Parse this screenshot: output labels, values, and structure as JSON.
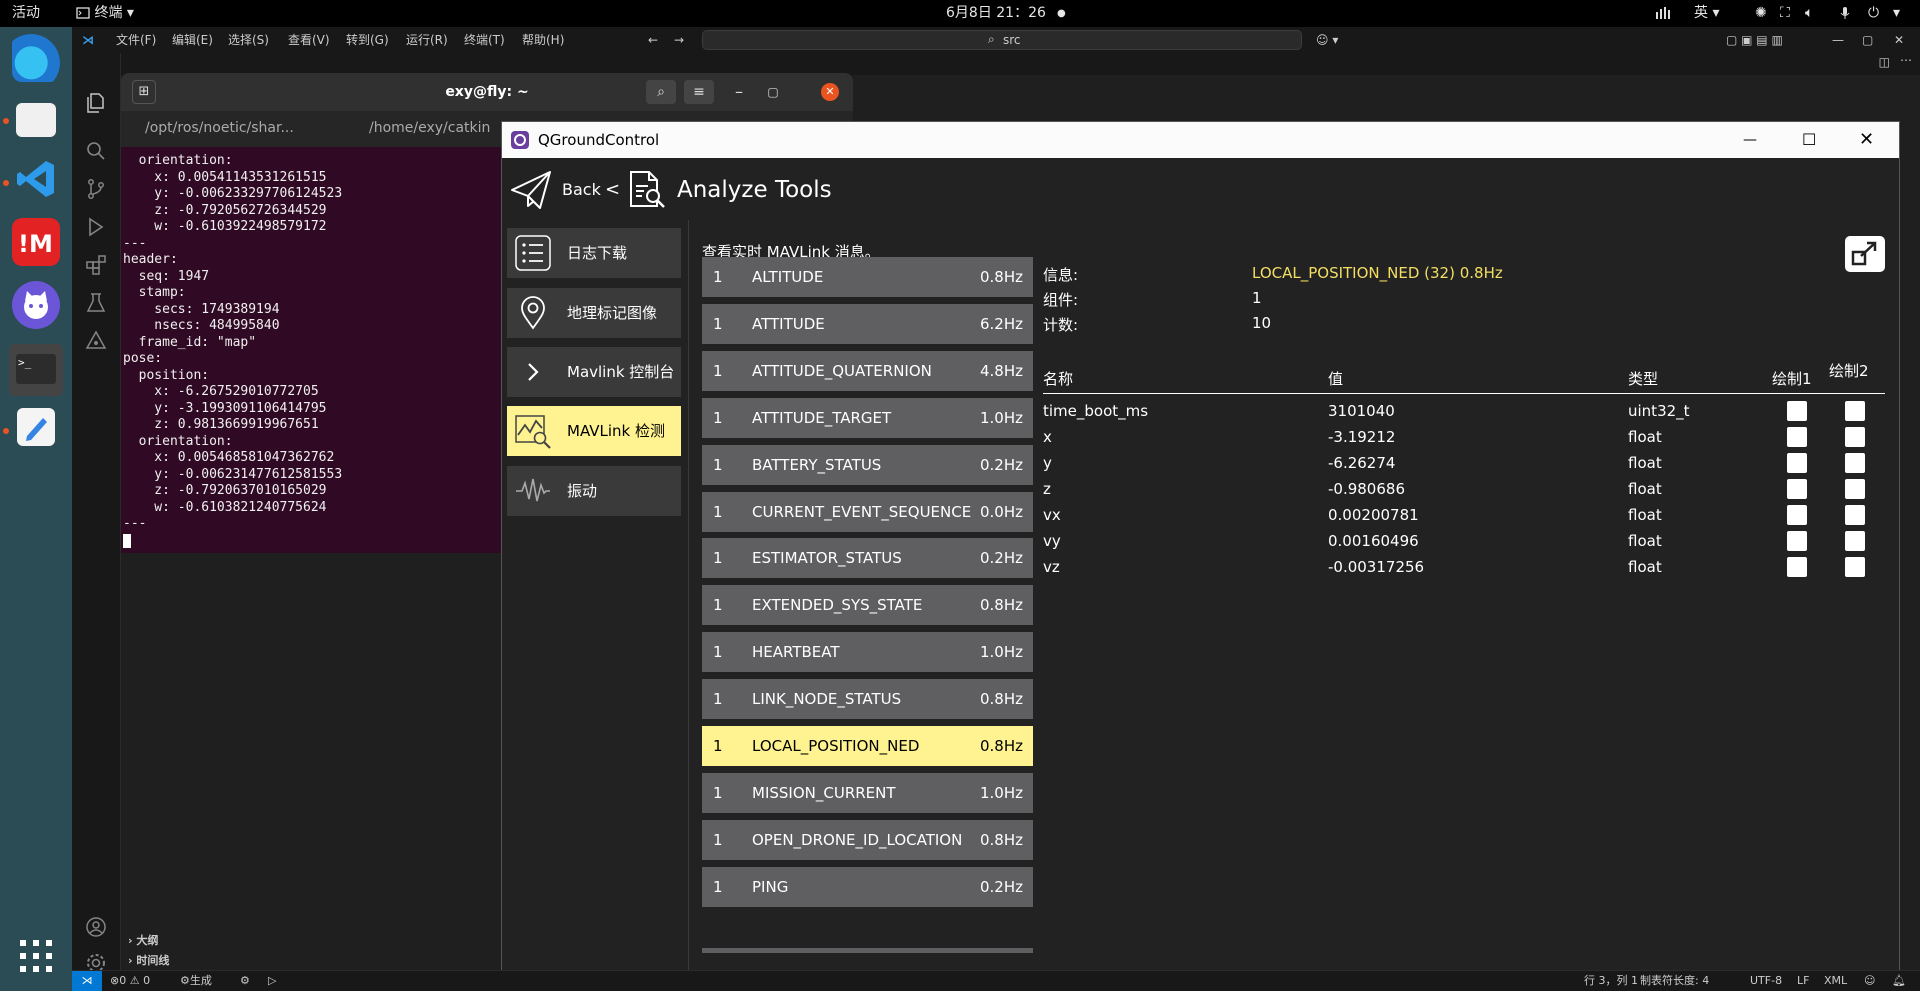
{
  "topbar": {
    "activities": "活动",
    "app_menu": "终端",
    "clock": "6月8日  21：26",
    "input_method": "英"
  },
  "vscode": {
    "menu": [
      "文件(F)",
      "编辑(E)",
      "选择(S)",
      "查看(V)",
      "转到(G)",
      "运行(R)",
      "终端(T)",
      "帮助(H)"
    ],
    "search": "src",
    "outline": "大纲",
    "timeline": "时间线",
    "status_problems": "0 ⚠ 0",
    "status_left_label": "生成",
    "status_right": [
      "行 3，列 1",
      "制表符长度: 4",
      "UTF-8",
      "LF",
      "XML"
    ]
  },
  "terminal": {
    "title": "exy@fly: ~",
    "tab1": "/opt/ros/noetic/shar...",
    "tab2": "/home/exy/catkin",
    "lines": [
      "  orientation:",
      "    x: 0.0054114353126151​5",
      "    y: -0.006233297706124523",
      "    z: -0.7920562726344529",
      "    w: -0.6103922498579172",
      "---",
      "header:",
      "  seq: 1947",
      "  stamp:",
      "    secs: 1749389194",
      "    nsecs: 484995840",
      "  frame_id: \"map\"",
      "pose:",
      "  position:",
      "    x: -6.267529010772705",
      "    y: -3.1993091106414795",
      "    z: 0.9813669919967651",
      "  orientation:",
      "    x: 0.005468581047362762",
      "    y: -0.006231477612581553",
      "    z: -0.7920637010165029",
      "    w: -0.6103821240775624",
      "---"
    ]
  },
  "qgc": {
    "window_title": "QGroundControl",
    "back": "Back",
    "separator": "<",
    "page_title": "Analyze Tools",
    "nav": [
      {
        "label": "日志下载",
        "icon": "list-icon"
      },
      {
        "label": "地理标记图像",
        "icon": "map-pin-icon"
      },
      {
        "label": "Mavlink 控制台",
        "icon": "chevron-right-icon"
      },
      {
        "label": "MAVLink 检测",
        "icon": "chart-search-icon"
      },
      {
        "label": "振动",
        "icon": "waveform-icon"
      }
    ],
    "header_text": "查看实时 MAVLink 消息。",
    "messages": [
      {
        "cid": "1",
        "name": "ALTITUDE",
        "hz": "0.8Hz"
      },
      {
        "cid": "1",
        "name": "ATTITUDE",
        "hz": "6.2Hz"
      },
      {
        "cid": "1",
        "name": "ATTITUDE_QUATERNION",
        "hz": "4.8Hz"
      },
      {
        "cid": "1",
        "name": "ATTITUDE_TARGET",
        "hz": "1.0Hz"
      },
      {
        "cid": "1",
        "name": "BATTERY_STATUS",
        "hz": "0.2Hz"
      },
      {
        "cid": "1",
        "name": "CURRENT_EVENT_SEQUENCE",
        "hz": "0.0Hz"
      },
      {
        "cid": "1",
        "name": "ESTIMATOR_STATUS",
        "hz": "0.2Hz"
      },
      {
        "cid": "1",
        "name": "EXTENDED_SYS_STATE",
        "hz": "0.8Hz"
      },
      {
        "cid": "1",
        "name": "HEARTBEAT",
        "hz": "1.0Hz"
      },
      {
        "cid": "1",
        "name": "LINK_NODE_STATUS",
        "hz": "0.8Hz"
      },
      {
        "cid": "1",
        "name": "LOCAL_POSITION_NED",
        "hz": "0.8Hz"
      },
      {
        "cid": "1",
        "name": "MISSION_CURRENT",
        "hz": "1.0Hz"
      },
      {
        "cid": "1",
        "name": "OPEN_DRONE_ID_LOCATION",
        "hz": "0.8Hz"
      },
      {
        "cid": "1",
        "name": "PING",
        "hz": "0.2Hz"
      }
    ],
    "info": {
      "message_label": "信息:",
      "message_value": "LOCAL_POSITION_NED (32) 0.8Hz",
      "component_label": "组件:",
      "component_value": "1",
      "count_label": "计数:",
      "count_value": "10"
    },
    "table": {
      "col_name": "名称",
      "col_value": "值",
      "col_type": "类型",
      "col_plot1": "绘制1",
      "col_plot2": "绘制2",
      "rows": [
        {
          "name": "time_boot_ms",
          "value": "3101040",
          "type": "uint32_t"
        },
        {
          "name": "x",
          "value": "-3.19212",
          "type": "float"
        },
        {
          "name": "y",
          "value": "-6.26274",
          "type": "float"
        },
        {
          "name": "z",
          "value": "-0.980686",
          "type": "float"
        },
        {
          "name": "vx",
          "value": "0.00200781",
          "type": "float"
        },
        {
          "name": "vy",
          "value": "0.00160496",
          "type": "float"
        },
        {
          "name": "vz",
          "value": "-0.00317256",
          "type": "float"
        }
      ]
    },
    "colors": {
      "accent": "#fff291",
      "highlight_text": "#f4df63",
      "list_bg": "#5f5f62",
      "panel_bg": "#222222"
    }
  }
}
